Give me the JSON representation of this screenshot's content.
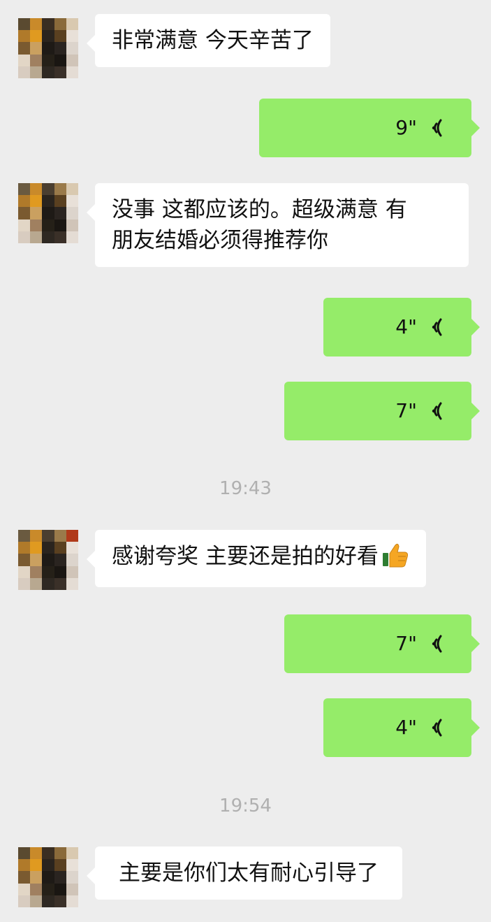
{
  "chat": {
    "messages": [
      {
        "from": "them",
        "text": "非常满意 今天辛苦了"
      },
      {
        "from": "me",
        "type": "voice",
        "duration": "9\""
      },
      {
        "from": "them",
        "text_line1": "没事 这都应该的。超级满意 有",
        "text_line2": "朋友结婚必须得推荐你"
      },
      {
        "from": "me",
        "type": "voice",
        "duration": "4\""
      },
      {
        "from": "me",
        "type": "voice",
        "duration": "7\""
      },
      {
        "from": "them",
        "text": "感谢夸奖 主要还是拍的好看",
        "emoji": "thumbs-up"
      },
      {
        "from": "me",
        "type": "voice",
        "duration": "7\""
      },
      {
        "from": "me",
        "type": "voice",
        "duration": "4\""
      },
      {
        "from": "them",
        "text": "主要是你们太有耐心引导了"
      }
    ],
    "timestamps": [
      "19:43",
      "19:54"
    ]
  },
  "colors": {
    "background": "#ededed",
    "incoming_bubble": "#ffffff",
    "outgoing_bubble": "#95ec69",
    "timestamp_text": "#b0b0b0"
  }
}
